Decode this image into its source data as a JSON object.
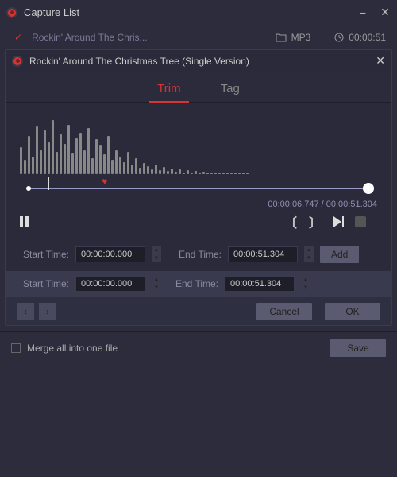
{
  "window": {
    "title": "Capture List"
  },
  "file": {
    "name": "Rockin' Around The Chris...",
    "format": "MP3",
    "duration": "00:00:51"
  },
  "panel": {
    "title": "Rockin' Around The Christmas Tree (Single Version)"
  },
  "tabs": {
    "trim": "Trim",
    "tag": "Tag"
  },
  "timeline": {
    "current": "00:00:06.747",
    "total": "00:00:51.304",
    "marker_percent": 22,
    "playhead_percent": 6
  },
  "trim": {
    "start_label": "Start Time:",
    "end_label": "End Time:",
    "start_value": "00:00:00.000",
    "end_value": "00:00:51.304",
    "add_label": "Add"
  },
  "segment": {
    "start_label": "Start Time:",
    "end_label": "End Time:",
    "start_value": "00:00:00.000",
    "end_value": "00:00:51.304"
  },
  "nav": {
    "cancel": "Cancel",
    "ok": "OK"
  },
  "footer": {
    "merge_label": "Merge all into one file",
    "save": "Save"
  },
  "waveform": [
    34,
    18,
    48,
    22,
    60,
    30,
    55,
    40,
    68,
    28,
    50,
    38,
    62,
    26,
    45,
    52,
    30,
    58,
    20,
    44,
    36,
    25,
    48,
    18,
    30,
    22,
    15,
    28,
    12,
    20,
    8,
    14,
    10,
    6,
    12,
    5,
    9,
    4,
    7,
    3,
    6,
    2,
    5,
    2,
    4,
    1,
    3,
    1,
    2,
    1,
    2,
    1,
    1,
    1,
    1,
    1,
    1,
    1
  ]
}
